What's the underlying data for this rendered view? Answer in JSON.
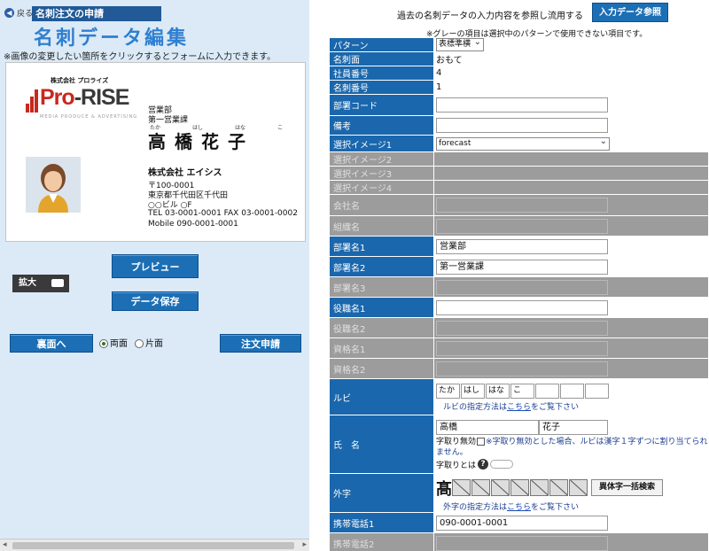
{
  "header": {
    "back_label": "戻る",
    "breadcrumb": "名刺注文の申請",
    "title": "名刺データ編集",
    "note": "※画像の変更したい箇所をクリックするとフォームに入力できます。"
  },
  "card": {
    "logo_small": "株式会社 プロライズ",
    "logo_pro": "Pro",
    "logo_rise": "-RISE",
    "logo_tag": "MEDIA PRODUCE & ADVERTISING",
    "dept1": "営業部",
    "dept2": "第一営業課",
    "ruby": [
      "たか",
      "はし",
      "はな",
      "こ"
    ],
    "name": "高橋花子",
    "company": "株式会社 エイシス",
    "postal": "〒100-0001",
    "address": "東京都千代田区千代田",
    "building": "○○ビル ○F",
    "tel_fax": "TEL 03-0001-0001 FAX 03-0001-0002",
    "mobile": "Mobile 090-0001-0001"
  },
  "controls": {
    "preview": "プレビュー",
    "save": "データ保存",
    "zoom": "拡大",
    "back_side": "裏面へ",
    "both_sides": "両面",
    "one_side": "片面",
    "order": "注文申請"
  },
  "right": {
    "past_label": "過去の名刺データの入力内容を参照し流用する",
    "ref_button": "入力データ参照",
    "gray_note": "※グレーの項目は選択中のパターンで使用できない項目です。",
    "rows": {
      "pattern": {
        "label": "パターン",
        "value": "表標準横"
      },
      "side": {
        "label": "名刺面",
        "value": "おもて"
      },
      "staff_no": {
        "label": "社員番号",
        "value": "4"
      },
      "card_no": {
        "label": "名刺番号",
        "value": "1"
      },
      "dept_code": {
        "label": "部署コード",
        "value": ""
      },
      "remarks": {
        "label": "備考",
        "value": ""
      },
      "image1": {
        "label": "選択イメージ1",
        "value": "forecast"
      },
      "image2": {
        "label": "選択イメージ2"
      },
      "image3": {
        "label": "選択イメージ3"
      },
      "image4": {
        "label": "選択イメージ4"
      },
      "company": {
        "label": "会社名"
      },
      "org": {
        "label": "組織名"
      },
      "dept1": {
        "label": "部署名1",
        "value": "営業部"
      },
      "dept2": {
        "label": "部署名2",
        "value": "第一営業課"
      },
      "dept3": {
        "label": "部署名3"
      },
      "title1": {
        "label": "役職名1",
        "value": ""
      },
      "title2": {
        "label": "役職名2"
      },
      "qual1": {
        "label": "資格名1"
      },
      "qual2": {
        "label": "資格名2"
      },
      "ruby": {
        "label": "ルビ",
        "boxes": [
          "たか",
          "はし",
          "はな",
          "こ",
          "",
          "",
          ""
        ],
        "help_pre": "ルビの指定方法は",
        "help_link": "こちら",
        "help_post": "をご覧下さい"
      },
      "name": {
        "label": "氏　名",
        "last": "高橋",
        "first": "花子",
        "kerning_label": "字取り無効",
        "kerning_note": "※字取り無効とした場合、ルビは漢字１字ずつに割り当てられません。",
        "what_label": "字取りとは"
      },
      "gaiji": {
        "label": "外字",
        "char": "髙",
        "search_button": "異体字一括検索",
        "help_pre": "外字の指定方法は",
        "help_link": "こちら",
        "help_post": "をご覧下さい"
      },
      "mobile1": {
        "label": "携帯電話1",
        "value": "090-0001-0001"
      },
      "mobile2": {
        "label": "携帯電話2"
      }
    }
  }
}
